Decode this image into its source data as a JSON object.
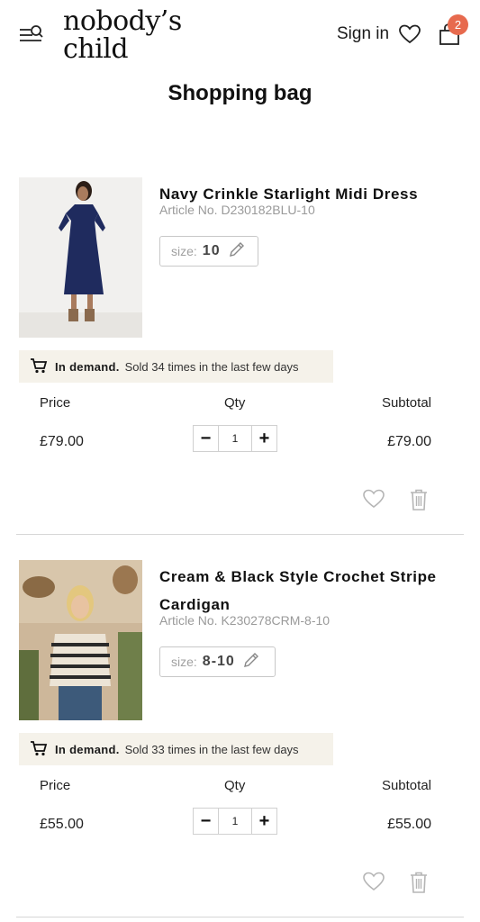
{
  "header": {
    "brand_line1": "nobody’s",
    "brand_line2": "child",
    "sign_in": "Sign in",
    "bag_count": "2"
  },
  "page": {
    "title": "Shopping bag"
  },
  "columns": {
    "price": "Price",
    "qty": "Qty",
    "subtotal": "Subtotal"
  },
  "items": [
    {
      "name": "Navy Crinkle Starlight Midi Dress",
      "article": "Article No. D230182BLU-10",
      "size_label": "size:",
      "size_value": "10",
      "demand_label": "In demand.",
      "demand_text": "Sold 34 times in the last few days",
      "price": "£79.00",
      "qty": "1",
      "subtotal": "£79.00"
    },
    {
      "name": "Cream & Black Style Crochet Stripe Cardigan",
      "article": "Article No. K230278CRM-8-10",
      "size_label": "size:",
      "size_value": "8-10",
      "demand_label": "In demand.",
      "demand_text": "Sold 33 times in the last few days",
      "price": "£55.00",
      "qty": "1",
      "subtotal": "£55.00"
    }
  ],
  "icons": {
    "menu": "menu-search-icon",
    "wishlist": "heart-icon",
    "bag": "shopping-bag-icon",
    "cart": "cart-icon",
    "edit": "pencil-icon",
    "remove": "trash-icon"
  },
  "colors": {
    "badge": "#e76a4e",
    "demand_bg": "#f5f2ea",
    "muted_text": "#9a9a9a"
  }
}
